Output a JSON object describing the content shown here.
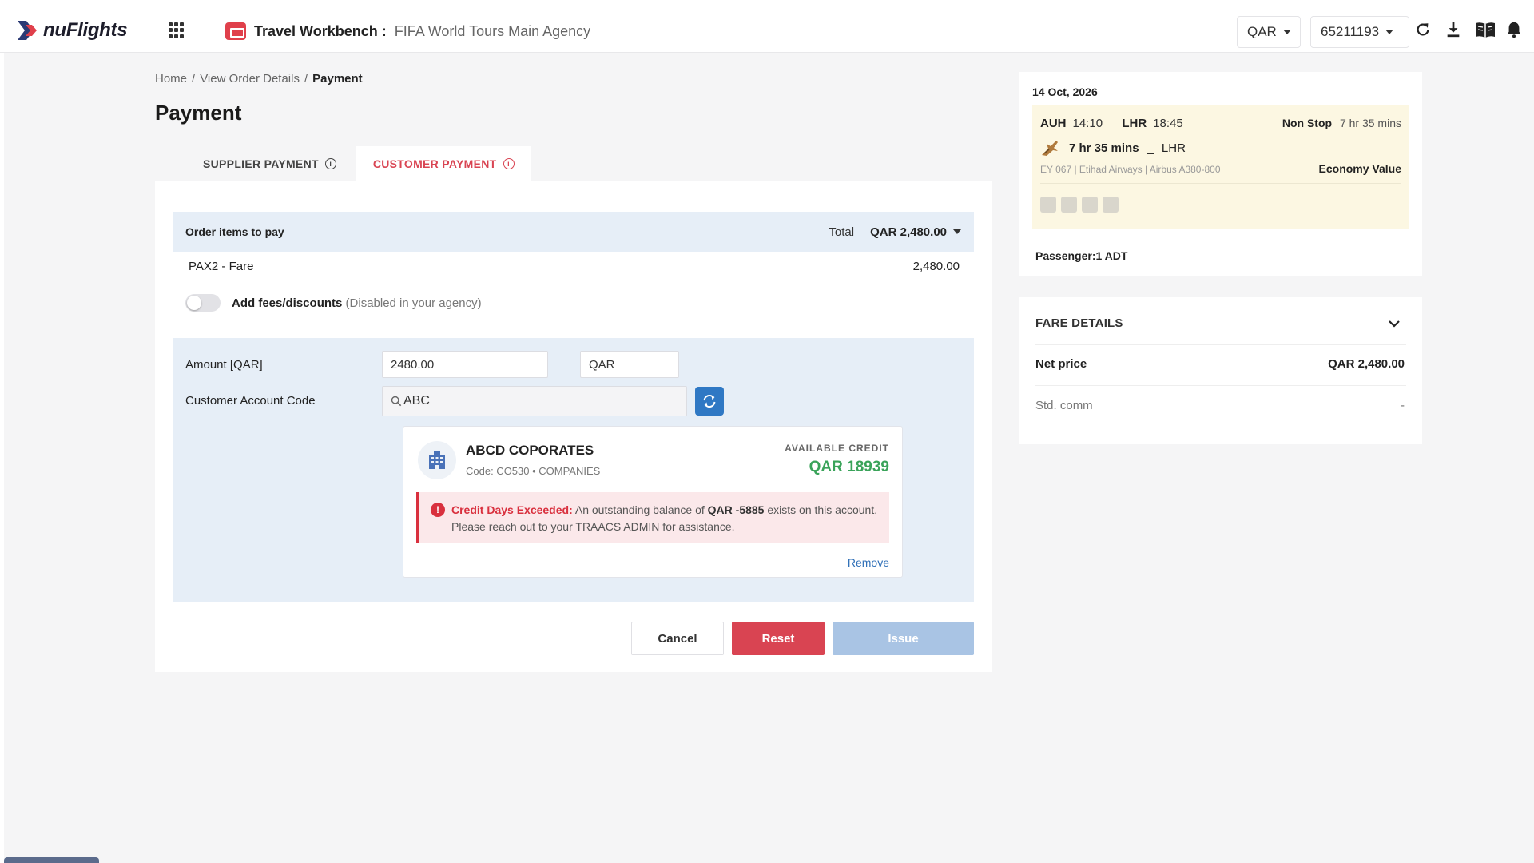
{
  "app": {
    "brand": "nuFlights",
    "workbench_title": "Travel Workbench :",
    "workbench_agency": "FIFA World Tours Main Agency",
    "currency": "QAR",
    "account_id": "65211193",
    "icons": [
      "apps-grid-icon",
      "workbench-icon",
      "refresh-icon",
      "download-icon",
      "book-icon",
      "bell-icon"
    ]
  },
  "breadcrumb": {
    "home": "Home",
    "sep1": "/",
    "order": "View Order Details",
    "sep2": "/",
    "current": "Payment"
  },
  "page_title": "Payment",
  "tabs": [
    {
      "label": "SUPPLIER PAYMENT",
      "active": false
    },
    {
      "label": "CUSTOMER PAYMENT",
      "active": true
    }
  ],
  "order": {
    "header": "Order items to pay",
    "total_label": "Total",
    "total_value": "QAR 2,480.00",
    "item_label": "PAX2  - Fare",
    "item_amount": "2,480.00",
    "fees_label": "Add fees/discounts",
    "fees_note": "(Disabled in your agency)"
  },
  "payment": {
    "amount_label": "Amount [QAR]",
    "amount_value": "2480.00",
    "currency_value": "QAR",
    "account_label": "Customer Account Code",
    "account_search": "ABC"
  },
  "customer": {
    "name": "ABCD COPORATES",
    "code": "Code: CO530 • COMPANIES",
    "available_label": "AVAILABLE CREDIT",
    "available_value": "QAR 18939",
    "alert_title": "Credit Days Exceeded:",
    "alert_pre": "An outstanding balance of",
    "alert_amount": "QAR -5885",
    "alert_post": "exists on this account. Please reach out to your TRAACS ADMIN for assistance.",
    "remove_label": "Remove"
  },
  "actions": {
    "cancel": "Cancel",
    "reset": "Reset",
    "issue": "Issue"
  },
  "flight": {
    "date": "14 Oct, 2026",
    "from": "AUH",
    "dep_time": "14:10",
    "to": "LHR",
    "arr_time": "18:45",
    "stops": "Non Stop",
    "duration_top": "7 hr 35 mins",
    "duration": "7 hr 35 mins",
    "to_short": "LHR",
    "dash": "_",
    "details": "EY 067 | Etihad Airways | Airbus A380-800",
    "cabin": "Economy Value",
    "passenger": "Passenger:1 ADT"
  },
  "fare": {
    "header": "FARE DETAILS",
    "net_label": "Net price",
    "net_value": "QAR 2,480.00",
    "comm_label": "Std. comm",
    "comm_value": "-"
  },
  "colors": {
    "accent_red": "#d94452",
    "primary_blue": "#2f78c4",
    "credit_green": "#3aa35a",
    "panel_blue": "#e6eef7",
    "flight_bg": "#fcf7e2"
  }
}
